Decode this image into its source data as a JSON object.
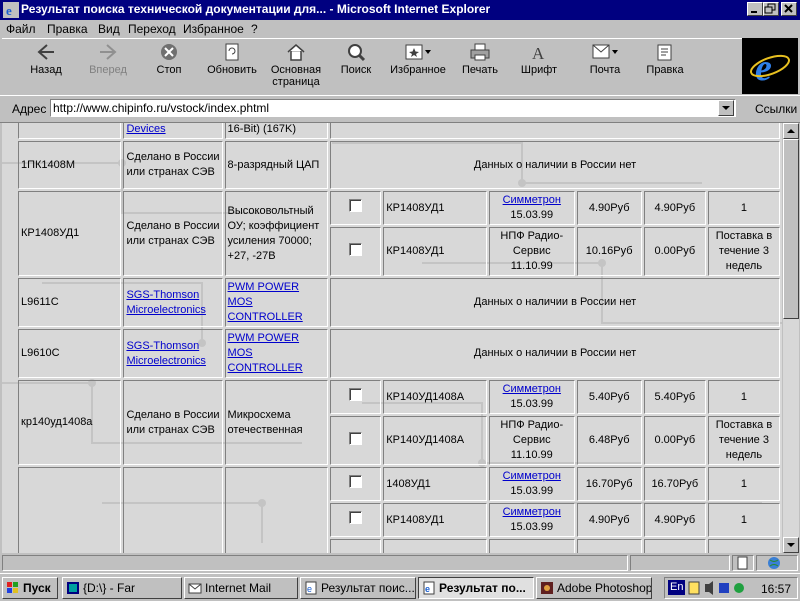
{
  "window": {
    "title": "Результат поиска технической документации для... - Microsoft Internet Explorer"
  },
  "menu": [
    "Файл",
    "Правка",
    "Вид",
    "Переход",
    "Избранное",
    "?"
  ],
  "toolbar": [
    {
      "label": "Назад",
      "icon": "back-arrow-icon"
    },
    {
      "label": "Вперед",
      "icon": "forward-arrow-icon",
      "disabled": true
    },
    {
      "label": "Стоп",
      "icon": "stop-icon"
    },
    {
      "label": "Обновить",
      "icon": "refresh-icon"
    },
    {
      "label": "Основная страница",
      "icon": "home-icon"
    },
    {
      "label": "Поиск",
      "icon": "search-icon"
    },
    {
      "label": "Избранное",
      "icon": "favorites-icon"
    },
    {
      "label": "Печать",
      "icon": "print-icon"
    },
    {
      "label": "Шрифт",
      "icon": "font-icon"
    },
    {
      "label": "Почта",
      "icon": "mail-icon"
    },
    {
      "label": "Правка",
      "icon": "edit-icon"
    }
  ],
  "address": {
    "label": "Адрес",
    "url": "http://www.chipinfo.ru/vstock/index.phtml",
    "links_label": "Ссылки"
  },
  "stock_table": {
    "top_partial": {
      "maker": "Devices",
      "desc": "16-Bit) (167K)"
    },
    "no_data_text": "Данных о наличии в России нет",
    "rows": [
      {
        "part": "1ПК1408М",
        "maker": "Сделано в России или странах СЭВ",
        "desc": "8-разрядный ЦАП",
        "no_data": true
      },
      {
        "part": "КР1408УД1",
        "maker": "Сделано в России или странах СЭВ",
        "desc": "Высоковольтный ОУ; коэффициент усиления 70000; +27, -27В",
        "offers": [
          {
            "name": "КР1408УД1",
            "supplier": "Симметрон",
            "supplier_link": true,
            "date": "15.03.99",
            "price": "4.90Руб",
            "price2": "4.90Руб",
            "qty": "1"
          },
          {
            "name": "КР1408УД1",
            "supplier": "НПФ Радио-Сервис",
            "supplier_link": false,
            "date": "11.10.99",
            "price": "10.16Руб",
            "price2": "0.00Руб",
            "qty": "Поставка в течение 3 недель"
          }
        ]
      },
      {
        "part": "L9611C",
        "maker": "SGS-Thomson Microelectronics",
        "maker_link": true,
        "desc": "PWM POWER MOS CONTROLLER",
        "desc_link": true,
        "no_data": true
      },
      {
        "part": "L9610C",
        "maker": "SGS-Thomson Microelectronics",
        "maker_link": true,
        "desc": "PWM POWER MOS CONTROLLER",
        "desc_link": true,
        "no_data": true
      },
      {
        "part": "кр140уд1408а",
        "maker": "Сделано в России или странах СЭВ",
        "desc": "Микросхема отечественная",
        "offers": [
          {
            "name": "КР140УД1408А",
            "supplier": "Симметрон",
            "supplier_link": true,
            "date": "15.03.99",
            "price": "5.40Руб",
            "price2": "5.40Руб",
            "qty": "1"
          },
          {
            "name": "КР140УД1408А",
            "supplier": "НПФ Радио-Сервис",
            "supplier_link": false,
            "date": "11.10.99",
            "price": "6.48Руб",
            "price2": "0.00Руб",
            "qty": "Поставка в течение 3 недель"
          }
        ]
      },
      {
        "part": "",
        "maker": "",
        "desc": "",
        "offers": [
          {
            "name": "1408УД1",
            "supplier": "Симметрон",
            "supplier_link": true,
            "date": "15.03.99",
            "price": "16.70Руб",
            "price2": "16.70Руб",
            "qty": "1"
          },
          {
            "name": "КР1408УД1",
            "supplier": "Симметрон",
            "supplier_link": true,
            "date": "15.03.99",
            "price": "4.90Руб",
            "price2": "4.90Руб",
            "qty": "1"
          },
          {
            "name": "",
            "supplier": "НПФ",
            "supplier_link": false,
            "date": "",
            "price": "",
            "price2": "",
            "qty": "Поставка в"
          }
        ]
      }
    ]
  },
  "taskbar": {
    "start": "Пуск",
    "items": [
      {
        "label": "{D:\\} - Far",
        "active": false
      },
      {
        "label": "Internet Mail",
        "active": false
      },
      {
        "label": "Результат поис...",
        "active": false
      },
      {
        "label": "Результат по...",
        "active": true
      },
      {
        "label": "Adobe Photoshop",
        "active": false
      }
    ],
    "lang": "En",
    "clock": "16:57"
  }
}
